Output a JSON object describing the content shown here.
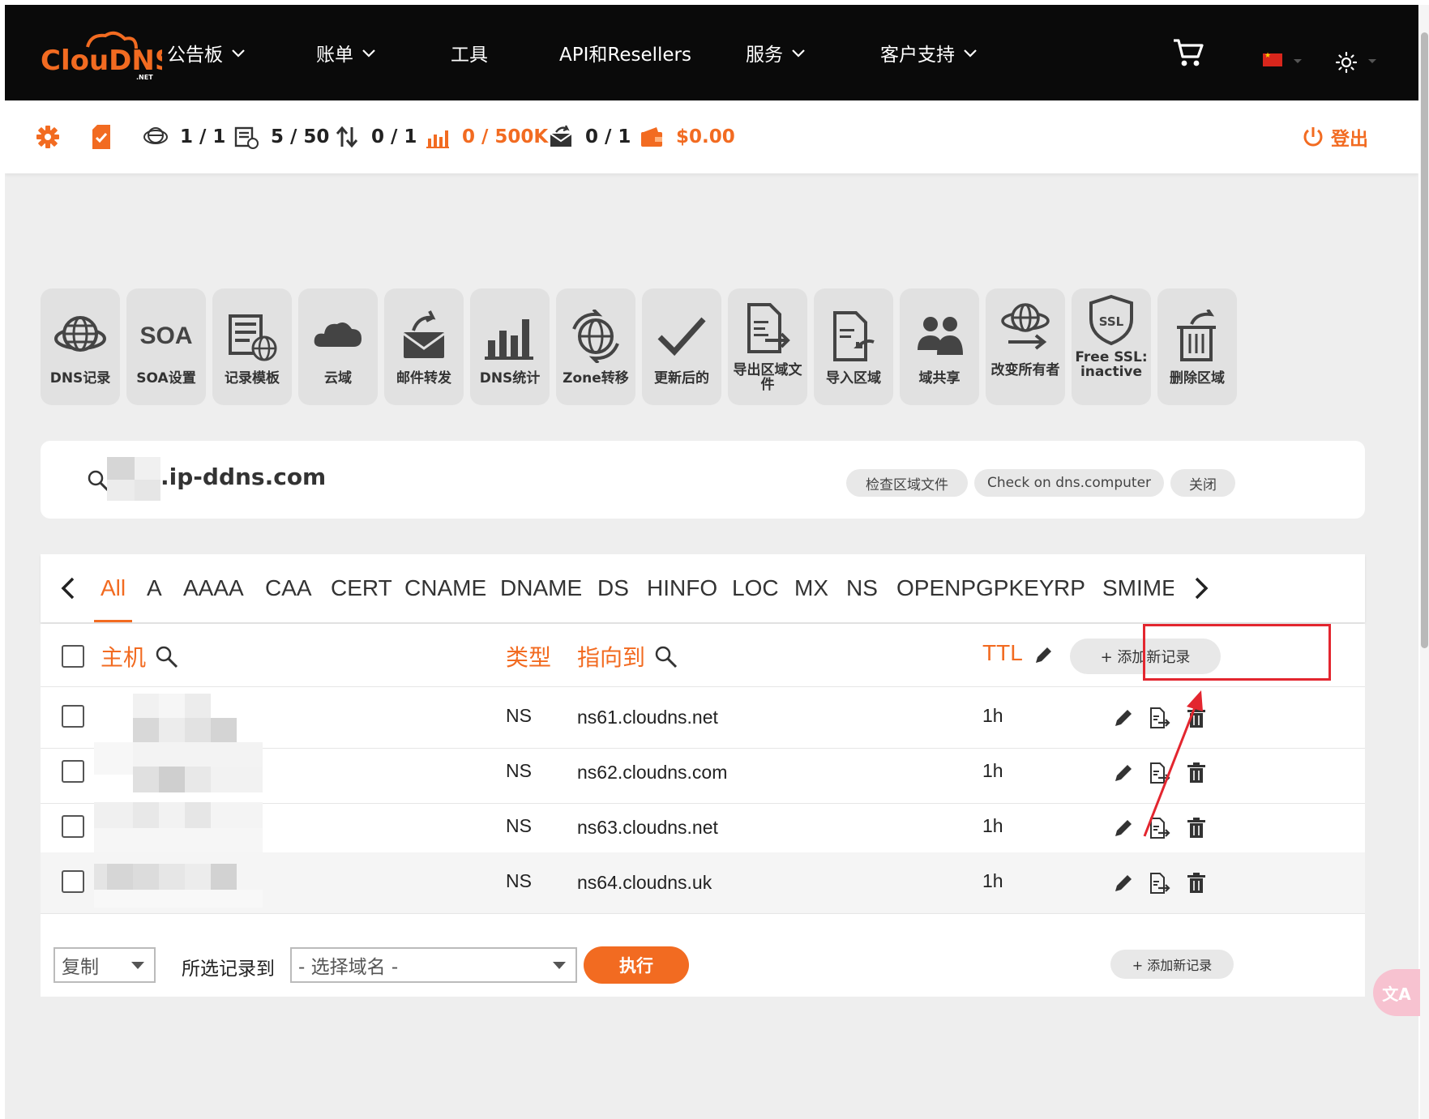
{
  "brand": {
    "logo_main": "ClouDNS",
    "logo_sub": ".NET"
  },
  "nav": {
    "items": [
      {
        "label": "公告板",
        "has_dropdown": true
      },
      {
        "label": "账单",
        "has_dropdown": true
      },
      {
        "label": "工具",
        "has_dropdown": false
      },
      {
        "label": "API和Resellers",
        "has_dropdown": false
      },
      {
        "label": "服务",
        "has_dropdown": true
      },
      {
        "label": "客户支持",
        "has_dropdown": true
      }
    ],
    "cart_icon": "shopping-cart-icon",
    "language_icon": "china-flag-icon",
    "theme_icon": "sun-icon"
  },
  "status": {
    "zones": "1 / 1",
    "records": "5 / 50",
    "transfers": "0 / 1",
    "queries": "0 / 500K",
    "mail_forwards": "0 / 1",
    "balance": "$0.00",
    "logout": "登出"
  },
  "actions": [
    {
      "label": "DNS记录",
      "icon": "globe-icon"
    },
    {
      "label": "SOA设置",
      "icon": "soa-text-icon",
      "text": "SOA"
    },
    {
      "label": "记录模板",
      "icon": "template-icon"
    },
    {
      "label": "云域",
      "icon": "cloud-icon"
    },
    {
      "label": "邮件转发",
      "icon": "mail-forward-icon"
    },
    {
      "label": "DNS统计",
      "icon": "bar-chart-icon"
    },
    {
      "label": "Zone转移",
      "icon": "zone-transfer-icon"
    },
    {
      "label": "更新后的",
      "icon": "check-icon"
    },
    {
      "label": "导出区域文件",
      "icon": "export-file-icon"
    },
    {
      "label": "导入区域",
      "icon": "import-file-icon"
    },
    {
      "label": "域共享",
      "icon": "users-icon"
    },
    {
      "label": "改变所有者",
      "icon": "change-owner-icon"
    },
    {
      "label": "Free SSL: inactive",
      "icon": "ssl-shield-icon"
    },
    {
      "label": "删除区域",
      "icon": "delete-zone-icon"
    }
  ],
  "domain": {
    "name_suffix": ".ip-ddns.com",
    "buttons": [
      "检查区域文件",
      "Check on dns.computer",
      "关闭"
    ]
  },
  "record_types": [
    "All",
    "A",
    "AAAA",
    "CAA",
    "CERT",
    "CNAME",
    "DNAME",
    "DS",
    "HINFO",
    "LOC",
    "MX",
    "NS",
    "OPENPGPKEY",
    "RP",
    "SMIMEA"
  ],
  "active_type": "All",
  "table": {
    "headers": {
      "host": "主机",
      "type": "类型",
      "points_to": "指向到",
      "ttl": "TTL"
    },
    "add_button": "+ 添加新记录",
    "rows": [
      {
        "type": "NS",
        "points_to": "ns61.cloudns.net",
        "ttl": "1h"
      },
      {
        "type": "NS",
        "points_to": "ns62.cloudns.com",
        "ttl": "1h"
      },
      {
        "type": "NS",
        "points_to": "ns63.cloudns.net",
        "ttl": "1h"
      },
      {
        "type": "NS",
        "points_to": "ns64.cloudns.uk",
        "ttl": "1h"
      }
    ]
  },
  "footer": {
    "action_select": "复制",
    "label": "所选记录到",
    "domain_select": "- 选择域名 -",
    "run": "执行",
    "add_button": "+ 添加新记录"
  },
  "colors": {
    "accent": "#f26b21",
    "nav_bg": "#0a0a0a",
    "annotation": "#e3262f"
  }
}
